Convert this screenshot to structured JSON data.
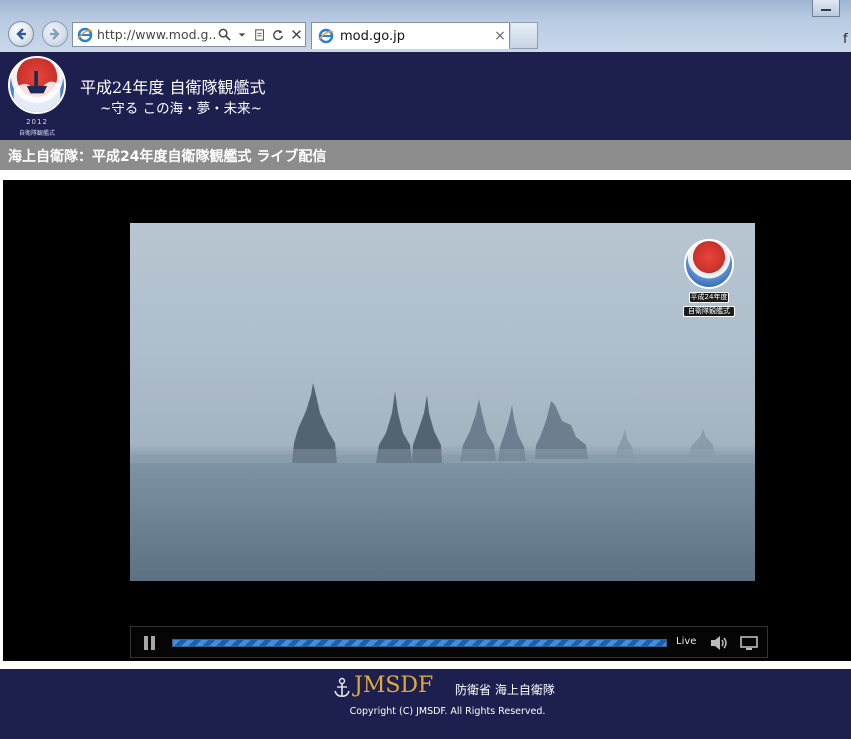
{
  "browser": {
    "address_url": "http://www.mod.g...",
    "tab_title": "mod.go.jp",
    "tab_close_glyph": "×",
    "address_tools": [
      "search-icon",
      "dropdown-icon",
      "compat-icon",
      "refresh-icon",
      "stop-icon"
    ]
  },
  "header": {
    "logo_year": "2012",
    "logo_caption": "自衛隊観艦式",
    "title": "平成24年度 自衛隊観艦式",
    "subtitle": "~守る この海・夢・未来~"
  },
  "section": {
    "title": "海上自衛隊：平成24年度自衛隊観艦式 ライブ配信"
  },
  "player": {
    "watermark_line1": "平成24年度",
    "watermark_line2": "自衛隊観艦式",
    "live_label": "Live",
    "progress": 1.0,
    "state": "playing"
  },
  "footer": {
    "brand": "JMSDF",
    "ministry": "防衛省  海上自衛隊",
    "copyright": "Copyright (C) JMSDF. All Rights Reserved."
  },
  "colors": {
    "header_bg": "#1d1f4f",
    "section_bar_bg": "#8c8c8c",
    "brand_gold": "#e0a93a",
    "progress_blue": "#3f8fe0"
  }
}
